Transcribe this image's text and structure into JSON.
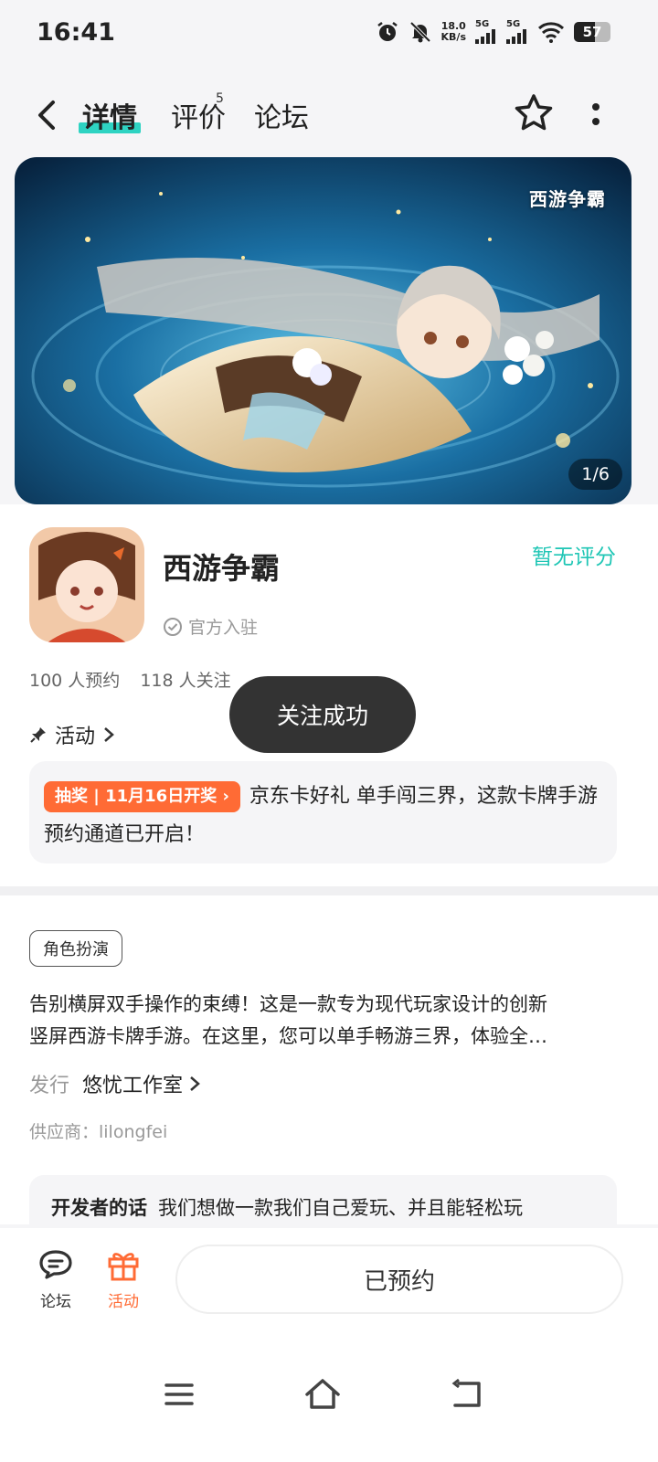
{
  "status_bar": {
    "time": "16:41",
    "net_speed_value": "18.0",
    "net_speed_unit": "KB/s",
    "sim1_label": "5G",
    "sim2_label": "5G",
    "battery": "57"
  },
  "header": {
    "tabs": [
      {
        "label": "详情"
      },
      {
        "label": "评价",
        "badge": "5"
      },
      {
        "label": "论坛"
      }
    ],
    "accent_color": "#2ed3c2"
  },
  "banner": {
    "logo_text": "西游争霸",
    "counter": "1/6"
  },
  "app": {
    "name": "西游争霸",
    "rating": "暂无评分",
    "official_label": "官方入驻",
    "reservations": "100 人预约",
    "followers": "118 人关注"
  },
  "toast": "关注成功",
  "activity": {
    "label": "活动",
    "tag": "抽奖 | 11月16日开奖",
    "text": "京东卡好礼 单手闯三界，这款卡牌手游预约通道已开启！"
  },
  "details": {
    "genre": "角色扮演",
    "description_line1": "告别横屏双手操作的束缚！这是一款专为现代玩家设计的创新",
    "description_line2": "竖屏西游卡牌手游。在这里，您可以单手畅游三界，体验全…",
    "publisher_key": "发行",
    "publisher_value": "悠忧工作室",
    "supplier": "供应商：lilongfei",
    "dev_key": "开发者的话",
    "dev_text": "我们想做一款我们自己爱玩、并且能轻松玩"
  },
  "bottom_bar": {
    "forum_label": "论坛",
    "activity_label": "活动",
    "reserve_label": "已预约",
    "activity_color": "#ff6b35"
  }
}
